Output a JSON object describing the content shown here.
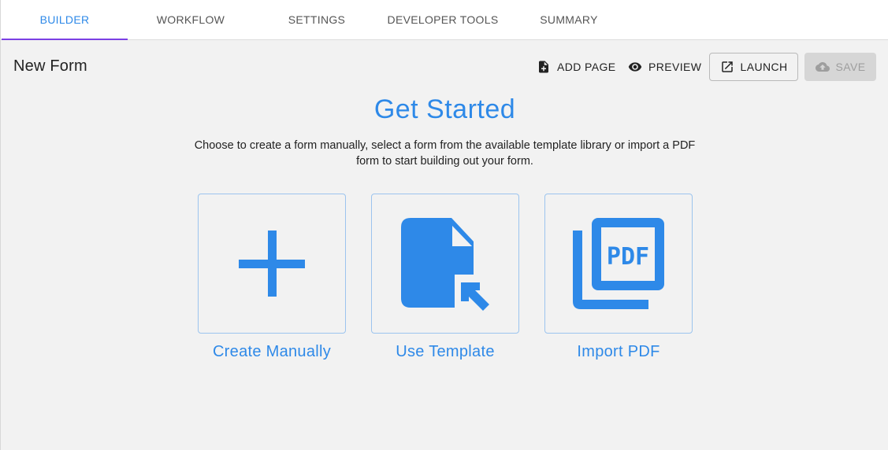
{
  "tabs": [
    {
      "label": "BUILDER",
      "active": true
    },
    {
      "label": "WORKFLOW",
      "active": false
    },
    {
      "label": "SETTINGS",
      "active": false
    },
    {
      "label": "DEVELOPER TOOLS",
      "active": false
    },
    {
      "label": "SUMMARY",
      "active": false
    }
  ],
  "form": {
    "title": "New Form"
  },
  "toolbar": {
    "add_page": {
      "label": "ADD PAGE",
      "icon": "add-page-icon"
    },
    "preview": {
      "label": "PREVIEW",
      "icon": "eye-icon"
    },
    "launch": {
      "label": "LAUNCH",
      "icon": "open-external-icon"
    },
    "save": {
      "label": "SAVE",
      "icon": "cloud-upload-icon",
      "disabled": true
    }
  },
  "hero": {
    "title": "Get Started",
    "description": "Choose to create a form manually, select a form from the available template library or import a PDF form to start building out your form."
  },
  "options": [
    {
      "label": "Create Manually",
      "icon": "plus-icon"
    },
    {
      "label": "Use Template",
      "icon": "template-file-icon"
    },
    {
      "label": "Import PDF",
      "icon": "pdf-icon"
    }
  ],
  "colors": {
    "accent": "#2e89e8",
    "tab_indicator": "#7b3fe4",
    "background": "#f2f2f2",
    "card_border": "#9cc4ee",
    "disabled_bg": "#d6d6d6"
  }
}
